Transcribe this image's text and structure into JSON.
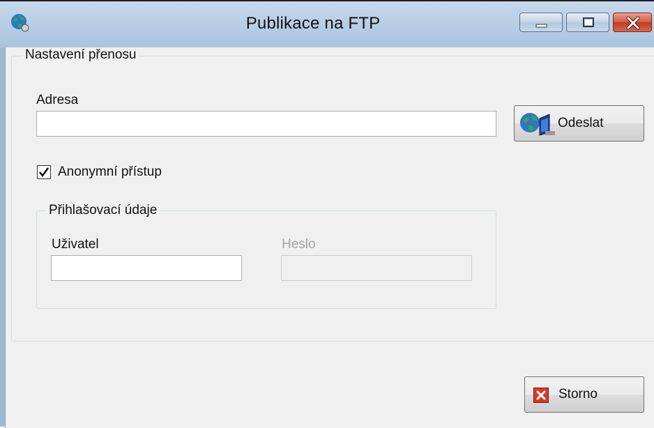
{
  "window": {
    "title": "Publikace na FTP",
    "controls": {
      "minimize": "minimize-icon",
      "maximize": "maximize-icon",
      "close": "close-icon"
    }
  },
  "transfer_group": {
    "legend": "Nastavení přenosu",
    "address_label": "Adresa",
    "address_value": "",
    "send_button": "Odeslat",
    "send_icon": "globe-computer-icon",
    "anonymous_checkbox": {
      "label": "Anonymní přístup",
      "checked": true
    }
  },
  "login_group": {
    "legend": "Přihlašovací údaje",
    "user_label": "Uživatel",
    "user_value": "",
    "password_label": "Heslo",
    "password_value": "",
    "password_enabled": false
  },
  "footer": {
    "cancel_button": "Storno",
    "cancel_icon": "red-x-icon"
  },
  "colors": {
    "titlebar": "#b3cbe4",
    "close_button": "#c8452b",
    "client_bg": "#f0f0f0"
  }
}
